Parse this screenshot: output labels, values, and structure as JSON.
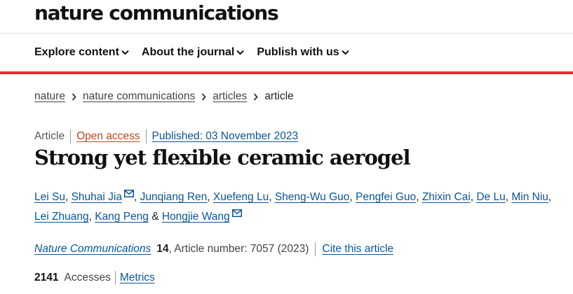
{
  "site": {
    "logo": "nature communications"
  },
  "nav": {
    "items": [
      {
        "label": "Explore content"
      },
      {
        "label": "About the journal"
      },
      {
        "label": "Publish with us"
      }
    ]
  },
  "breadcrumb": {
    "items": [
      "nature",
      "nature communications",
      "articles"
    ],
    "current": "article"
  },
  "article": {
    "type": "Article",
    "access": "Open access",
    "published": "Published: 03 November 2023",
    "title": "Strong yet flexible ceramic aerogel",
    "authors": [
      {
        "name": "Lei Su",
        "sep": ", "
      },
      {
        "name": "Shuhai Jia",
        "sep": ", "
      },
      {
        "name": "Junqiang Ren",
        "sep": ", "
      },
      {
        "name": "Xuefeng Lu",
        "sep": ", "
      },
      {
        "name": "Sheng-Wu Guo",
        "sep": ", "
      },
      {
        "name": "Pengfei Guo",
        "sep": ", "
      },
      {
        "name": "Zhixin Cai",
        "sep": ", "
      },
      {
        "name": "De Lu",
        "sep": ", "
      },
      {
        "name": "Min Niu",
        "sep": ", "
      },
      {
        "name": "Lei Zhuang",
        "sep": ", "
      },
      {
        "name": "Kang Peng",
        "sep": " & "
      },
      {
        "name": "Hongjie Wang",
        "sep": ""
      }
    ],
    "journal": "Nature Communications",
    "volume": "14",
    "article_number": ", Article number: 7057 (2023)",
    "cite_label": "Cite this article",
    "accesses_count": "2141",
    "accesses_label": "Accesses",
    "metrics_label": "Metrics"
  },
  "colors": {
    "accent_red": "#e0322b",
    "link_blue": "#0a5596",
    "open_access": "#b24a1a"
  }
}
